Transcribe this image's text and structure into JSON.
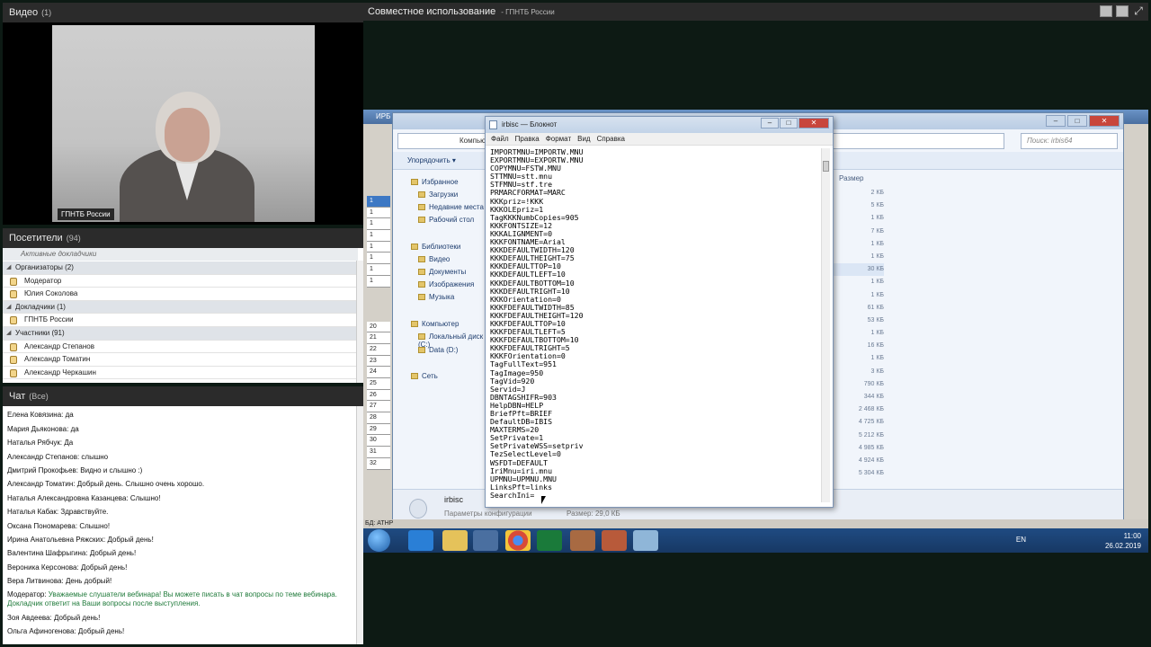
{
  "video": {
    "title": "Видео",
    "count": "(1)",
    "cam_label": "ГПНТБ России"
  },
  "attendees": {
    "title": "Посетители",
    "count": "(94)",
    "subheader": "Активные докладчики",
    "rows": [
      {
        "type": "group",
        "label": "Организаторы (2)"
      },
      {
        "type": "user",
        "label": "Модератор"
      },
      {
        "type": "user",
        "label": "Юлия Соколова"
      },
      {
        "type": "group",
        "label": "Докладчики (1)"
      },
      {
        "type": "user",
        "label": "ГПНТБ России"
      },
      {
        "type": "group",
        "label": "Участники (91)"
      },
      {
        "type": "user",
        "label": "Александр Степанов"
      },
      {
        "type": "user",
        "label": "Александр Томатин"
      },
      {
        "type": "user",
        "label": "Александр Черкашин"
      }
    ]
  },
  "chat": {
    "title": "Чат",
    "filter": "(Все)",
    "messages": [
      {
        "who": "Елена Ковязина:",
        "text": "да"
      },
      {
        "who": "Мария Дьяконова:",
        "text": "да"
      },
      {
        "who": "Наталья Рябчук:",
        "text": "Да"
      },
      {
        "who": "Александр Степанов:",
        "text": "слышно"
      },
      {
        "who": "Дмитрий Прокофьев:",
        "text": "Видно и слышно :)"
      },
      {
        "who": "Александр Томатин:",
        "text": "Добрый день. Слышно очень хорошо."
      },
      {
        "who": "Наталья Александровна Казанцева:",
        "text": "Слышно!"
      },
      {
        "who": "Наталья Кабак:",
        "text": "Здравствуйте."
      },
      {
        "who": "Оксана Пономарева:",
        "text": "Слышно!"
      },
      {
        "who": "Ирина Анатольевна Ряжских:",
        "text": "Добрый день!"
      },
      {
        "who": "Валентина Шафрыгина:",
        "text": "Добрый день!"
      },
      {
        "who": "Вероника Керсонова:",
        "text": "Добрый день!"
      },
      {
        "who": "Вера Литвинова:",
        "text": "День добрый!"
      },
      {
        "who": "Модератор:",
        "text": "Уважаемые слушатели вебинара! Вы можете писать в чат вопросы по теме вебинара. Докладчик ответит на Ваши вопросы после выступления.",
        "mod": true
      },
      {
        "who": "Зоя Авдеева:",
        "text": "Добрый день!"
      },
      {
        "who": "Ольга Афиногенова:",
        "text": "Добрый день!"
      }
    ]
  },
  "share": {
    "title": "Совместное использование",
    "subtitle": "- ГПНТБ России"
  },
  "irbis": {
    "title": "ИРБ",
    "rows": [
      "1",
      "1",
      "1",
      "1",
      "1",
      "1",
      "1",
      "1"
    ],
    "nums": [
      "20",
      "21",
      "22",
      "23",
      "24",
      "25",
      "26",
      "27",
      "28",
      "29",
      "30",
      "31",
      "32"
    ]
  },
  "explorer": {
    "address": "Компьютер",
    "search_placeholder": "Поиск: irbis64",
    "organize": "Упорядочить",
    "size_header": "Размер",
    "nav": [
      {
        "label": "Избранное",
        "hdr": true
      },
      {
        "label": "Загрузки"
      },
      {
        "label": "Недавние места"
      },
      {
        "label": "Рабочий стол"
      },
      {
        "label": "Библиотеки",
        "hdr": true
      },
      {
        "label": "Видео"
      },
      {
        "label": "Документы"
      },
      {
        "label": "Изображения"
      },
      {
        "label": "Музыка"
      },
      {
        "label": "Компьютер",
        "hdr": true
      },
      {
        "label": "Локальный диск (C:)"
      },
      {
        "label": "Data (D:)"
      },
      {
        "label": "Сеть",
        "hdr": true
      }
    ],
    "sizes": [
      "2 КБ",
      "5 КБ",
      "1 КБ",
      "7 КБ",
      "1 КБ",
      "1 КБ",
      "30 КБ",
      "1 КБ",
      "1 КБ",
      "61 КБ",
      "53 КБ",
      "1 КБ",
      "16 КБ",
      "1 КБ",
      "3 КБ",
      "790 КБ",
      "344 КБ",
      "2 468 КБ",
      "4 725 КБ",
      "5 212 КБ",
      "4 985 КБ",
      "4 924 КБ",
      "5 304 КБ"
    ],
    "status_name": "irbisc",
    "status_type": "Параметры конфигурации",
    "status_size": "Размер: 29,0 КБ"
  },
  "notepad": {
    "title": "irbisc — Блокнот",
    "menu": [
      "Файл",
      "Правка",
      "Формат",
      "Вид",
      "Справка"
    ],
    "lines": [
      "IMPORTMNU=IMPORTW.MNU",
      "EXPORTMNU=EXPORTW.MNU",
      "COPYMNU=FSTW.MNU",
      "STTMNU=stt.mnu",
      "STFMNU=stf.tre",
      "PRMARCFORMAT=MARC",
      "KKKpriz=!KKK",
      "KKKOLEpriz=1",
      "TagKKKNumbCopies=905",
      "KKKFONTSIZE=12",
      "KKKALIGNMENT=0",
      "KKKFONTNAME=Arial",
      "KKKDEFAULTWIDTH=120",
      "KKKDEFAULTHEIGHT=75",
      "KKKDEFAULTTOP=10",
      "KKKDEFAULTLEFT=10",
      "KKKDEFAULTBOTTOM=10",
      "KKKDEFAULTRIGHT=10",
      "KKKOrientation=0",
      "KKKFDEFAULTWIDTH=85",
      "KKKFDEFAULTHEIGHT=120",
      "KKKFDEFAULTTOP=10",
      "KKKFDEFAULTLEFT=5",
      "KKKFDEFAULTBOTTOM=10",
      "KKKFDEFAULTRIGHT=5",
      "KKKFOrientation=0",
      "TagFullText=951",
      "TagImage=950",
      "TagVid=920",
      "Servid=J",
      "DBNTAGSHIFR=903",
      "HelpDBN=HELP",
      "BriefPft=BRIEF",
      "DefaultDB=IBIS",
      "MAXTERMS=20",
      "SetPrivate=1",
      "SetPrivateWSS=setpriv",
      "TezSelectLevel=0",
      "WSFDT=DEFAULT",
      "IriMnu=iri.mnu",
      "UPMNU=UPMNU.MNU",
      "LinksPft=links",
      "SearchIni="
    ]
  },
  "taskbar": {
    "lang": "EN",
    "time": "11:00",
    "date": "26.02.2019",
    "status_strip": "БД: АТНР"
  }
}
